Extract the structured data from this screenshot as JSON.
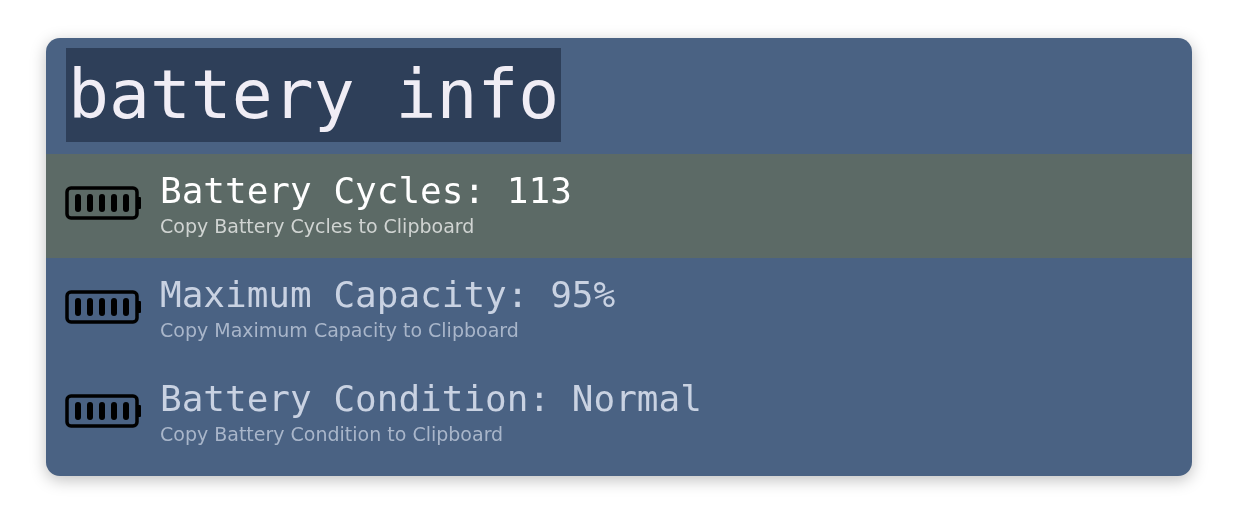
{
  "search": {
    "value": "battery info"
  },
  "results": [
    {
      "title": "Battery Cycles: 113",
      "subtitle": "Copy Battery Cycles to Clipboard",
      "selected": true
    },
    {
      "title": "Maximum Capacity: 95%",
      "subtitle": "Copy Maximum Capacity to Clipboard",
      "selected": false
    },
    {
      "title": "Battery Condition: Normal",
      "subtitle": "Copy Battery Condition to Clipboard",
      "selected": false
    }
  ]
}
